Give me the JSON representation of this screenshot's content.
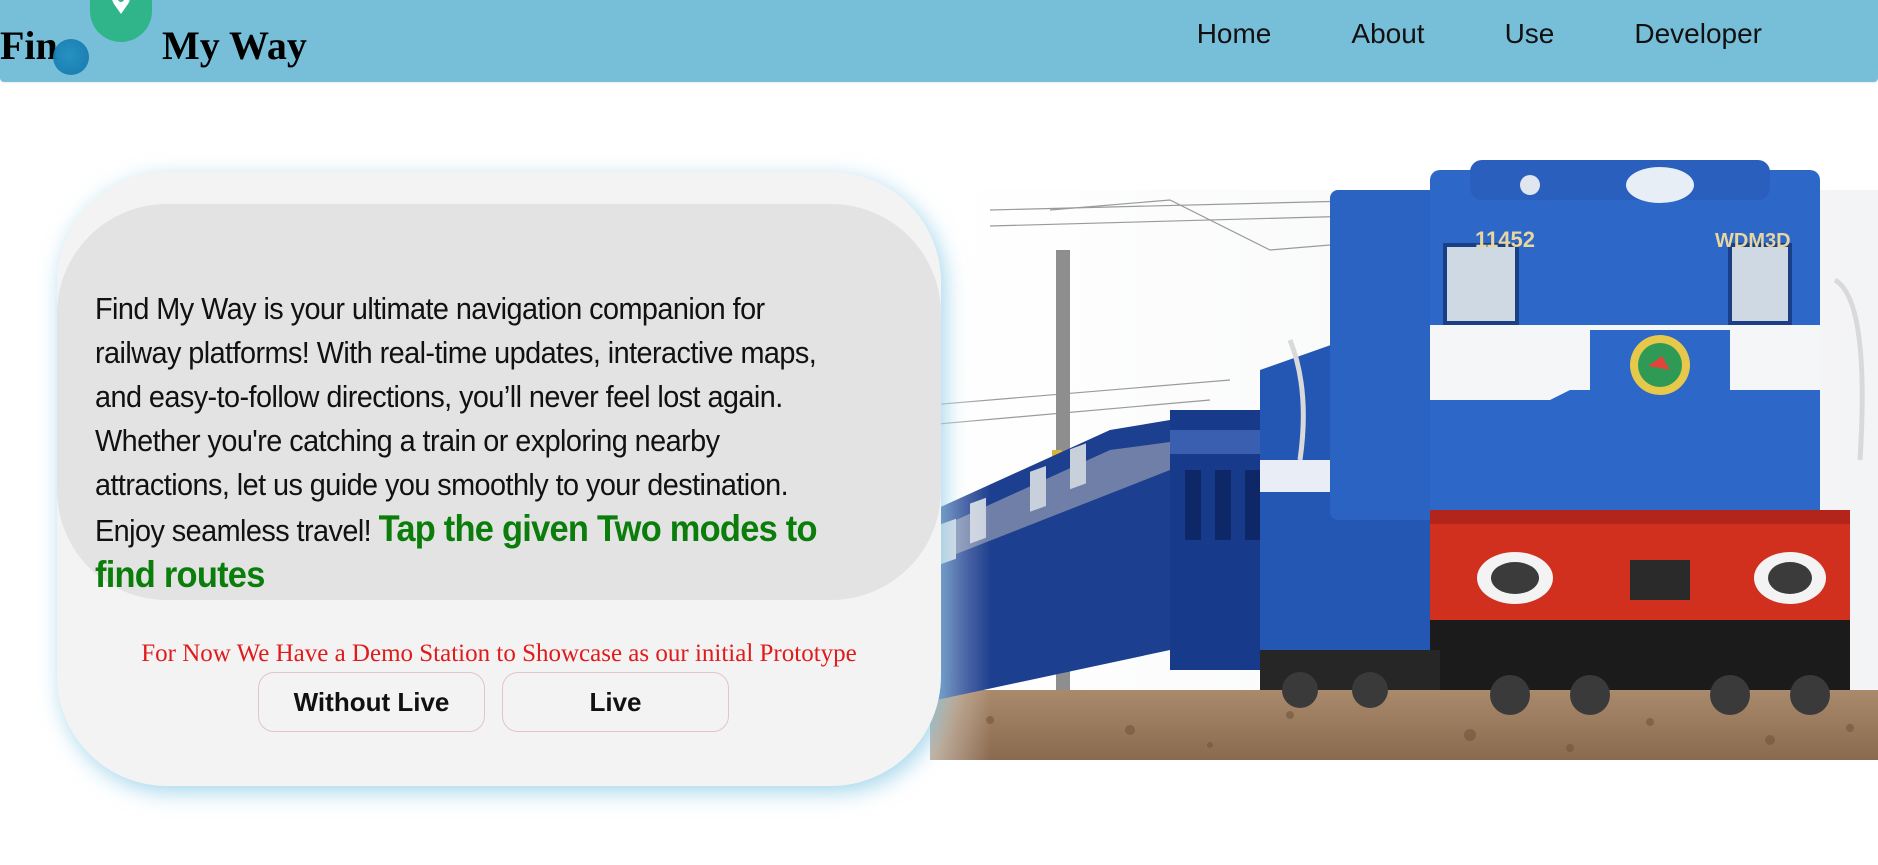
{
  "brand": {
    "name_first": "Fin",
    "name_second": "My Way",
    "logo_icon": "map-pin-icon",
    "colors": {
      "navbar": "#77bfd8",
      "logo_badge": "#2fb589",
      "logo_dot": "#157ab0"
    }
  },
  "nav": {
    "items": [
      {
        "label": "Home"
      },
      {
        "label": "About"
      },
      {
        "label": "Use"
      },
      {
        "label": "Developer"
      }
    ]
  },
  "intro": {
    "description": "Find My Way is your ultimate navigation companion for railway platforms! With real-time updates, interactive maps, and easy-to-follow directions, you’ll never feel lost again. Whether you're catching a train or exploring nearby attractions, let us guide you smoothly to your destination. Enjoy seamless travel!",
    "highlight": "Tap the given Two modes to find routes",
    "highlight_color": "#0b7d0b",
    "notice": "For Now We Have a Demo Station to Showcase as our initial Prototype",
    "notice_color": "#e01b1b"
  },
  "modes": {
    "without_live_label": "Without Live",
    "live_label": "Live"
  },
  "hero": {
    "alt": "railway-locomotive-image",
    "locomotive_number": "11452",
    "locomotive_class": "WDM3D"
  }
}
